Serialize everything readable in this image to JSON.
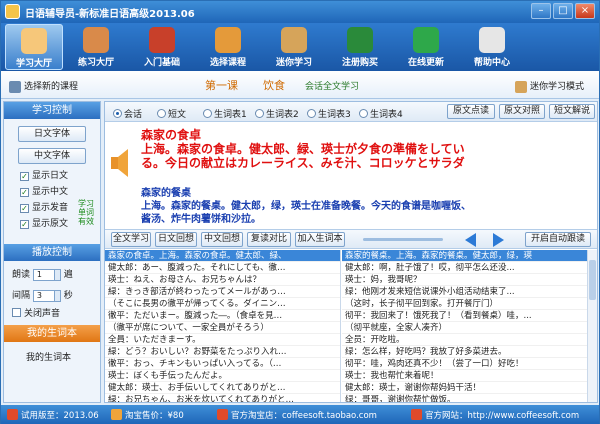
{
  "window": {
    "title": "日语辅导员-新标准日语高级2013.06",
    "minimize": "–",
    "maximize": "□",
    "close": "×"
  },
  "toolbar": [
    {
      "label": "学习大厅",
      "icon": "student-icon",
      "color": "#f6c77a",
      "active": true
    },
    {
      "label": "练习大厅",
      "icon": "practice-icon",
      "color": "#d98a4a",
      "active": false
    },
    {
      "label": "入门基础",
      "icon": "books-icon",
      "color": "#c8402a",
      "active": false
    },
    {
      "label": "选择课程",
      "icon": "course-icon",
      "color": "#e49a3a",
      "active": false
    },
    {
      "label": "迷你学习",
      "icon": "book-icon",
      "color": "#d6a45a",
      "active": false
    },
    {
      "label": "注册购买",
      "icon": "cart-icon",
      "color": "#2a8a3a",
      "active": false
    },
    {
      "label": "在线更新",
      "icon": "update-icon",
      "color": "#2ea84a",
      "active": false
    },
    {
      "label": "帮助中心",
      "icon": "help-icon",
      "color": "#e6e6e6",
      "active": false
    }
  ],
  "subbar": {
    "select_lesson": "选择新的课程",
    "lesson_num": "第一课",
    "lesson_title": "饮食",
    "fulltext_ex": "会话全文学习",
    "mini_mode": "迷你学习模式"
  },
  "left": {
    "study_control": "学习控制",
    "jp_font": "日文字体",
    "cn_font": "中文字体",
    "checks": [
      {
        "label": "显示日文",
        "checked": true
      },
      {
        "label": "显示中文",
        "checked": true
      },
      {
        "label": "显示发音",
        "checked": true
      },
      {
        "label": "显示原文",
        "checked": true
      }
    ],
    "vocab_tag": "学习单词有效",
    "play_control": "播放控制",
    "read_label": "朗读",
    "read_value": "1",
    "read_unit": "遍",
    "interval_label": "间隔",
    "interval_value": "3",
    "interval_unit": "秒",
    "close_sound": "关闭声音",
    "my_vocab": "我的生词本",
    "my_vocab_link": "我的生词本"
  },
  "main": {
    "radios": [
      {
        "label": "会话",
        "on": true
      },
      {
        "label": "短文",
        "on": false
      },
      {
        "label": "生词表1",
        "on": false
      },
      {
        "label": "生词表2",
        "on": false
      },
      {
        "label": "生词表3",
        "on": false
      },
      {
        "label": "生词表4",
        "on": false
      }
    ],
    "top_buttons": [
      "原文点读",
      "原文对照",
      "短文解说"
    ],
    "jp_lines": [
      "森家の食卓",
      "上海。森家の食卓。健太郎、緑、瑛士が夕食の準備をしてい",
      "る。今日の献立はカレーライス、みそ汁、コロッケとサラダ"
    ],
    "cn_lines": [
      "森家的餐桌",
      "上海。森家的餐桌。健太郎，绿，瑛士在准备晚餐。今天的食谱是咖喱饭、",
      "酱汤、炸牛肉薯饼和沙拉。"
    ],
    "action_buttons": [
      "全文学习",
      "日文回想",
      "中文回想",
      "复读对比",
      "加入生词本"
    ],
    "auto_read": "开启自动跟读",
    "jp_rows": [
      "森家の食卓。上海。森家の食卓。健太郎、緑、",
      "健太郎：あー、腹減った。それにしても、徹…",
      "瑛士：ねえ、お母さん、お兄ちゃんは？",
      "緑：きっき部活が終わったってメールがあっ…",
      "（そこに長男の徹平が帰ってくる。ダイニン…",
      "徹平：ただいまー。腹減った―。（食卓を見…",
      "（徹平が席について、一家全員がそろう）",
      "全員：いただきまーす。",
      "緑：どう？おいしい？お野菜をたっぷり入れ…",
      "徹平：おっ、チキンもいっぱい入ってる。（…",
      "瑛士：ぼくも手伝ったんだよ。",
      "健太郎：瑛士、お手伝いしてくれてありがと…",
      "緑：お兄ちゃん、お米を炊いてくれてありがと…"
    ],
    "cn_rows": [
      "森家的餐桌。上海。森家的餐桌。健太郎，绿，瑛",
      "健太郎：啊，肚子饿了！哎，彻平怎么还没...",
      "瑛士：妈，我哥呢？",
      "绿：他刚才发来短信说课外小组活动结束了...",
      "（这时，长子彻平回到家。打开餐厅门）",
      "彻平：我回来了！饿死我了！（看到餐桌）哇，...",
      "（彻平就座，全家人凑齐）",
      "全员：开吃啦。",
      "绿：怎么样，好吃吗？我放了好多菜进去。",
      "彻平：哇，鸡肉还真不少！（尝了一口）好吃！",
      "瑛士：我也帮忙来着呢！",
      "健太郎：瑛士，谢谢你帮妈妈干活！",
      "绿：哥哥，谢谢你帮忙做饭。"
    ]
  },
  "status": {
    "trial": "试用版至：2013.06",
    "taobao": "淘宝售价：¥80",
    "shop": "官方淘宝店：coffeesoft.taobao.com",
    "site": "官方网站：http://www.coffeesoft.com"
  }
}
